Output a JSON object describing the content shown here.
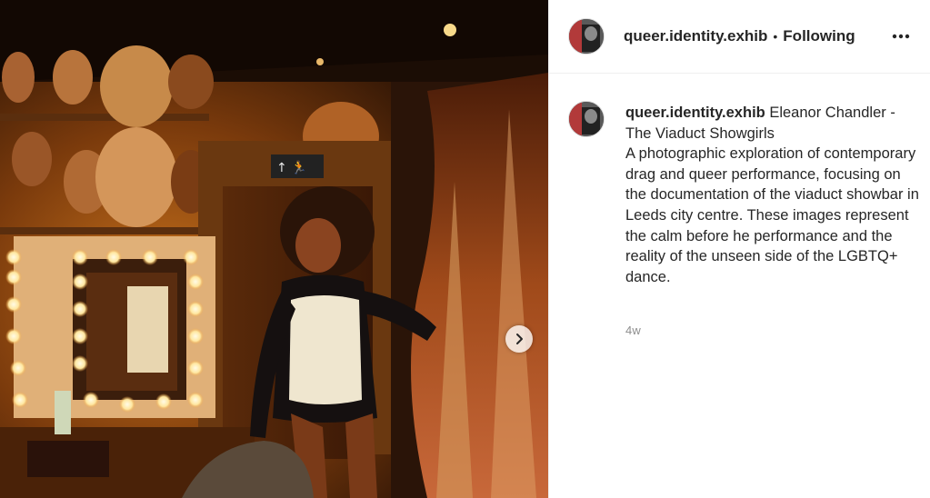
{
  "post": {
    "username": "queer.identity.exhib",
    "separator": "•",
    "follow_status": "Following",
    "caption_title": "Eleanor Chandler - The Viaduct Showgirls",
    "caption_text": "A photographic exploration of contemporary drag and queer performance, focusing on the documentation of the viaduct showbar in Leeds city centre. These images represent the calm before he performance and the reality of the unseen side of the LGBTQ+ dance.",
    "timestamp": "4w",
    "exit_sign_glyph": "↑ 🏃"
  },
  "icons": {
    "more": "more-options-icon",
    "next": "chevron-right-icon",
    "exit": "exit-sign-icon"
  },
  "colors": {
    "text": "#262626",
    "muted": "#8e8e8e",
    "border": "#efefef"
  }
}
